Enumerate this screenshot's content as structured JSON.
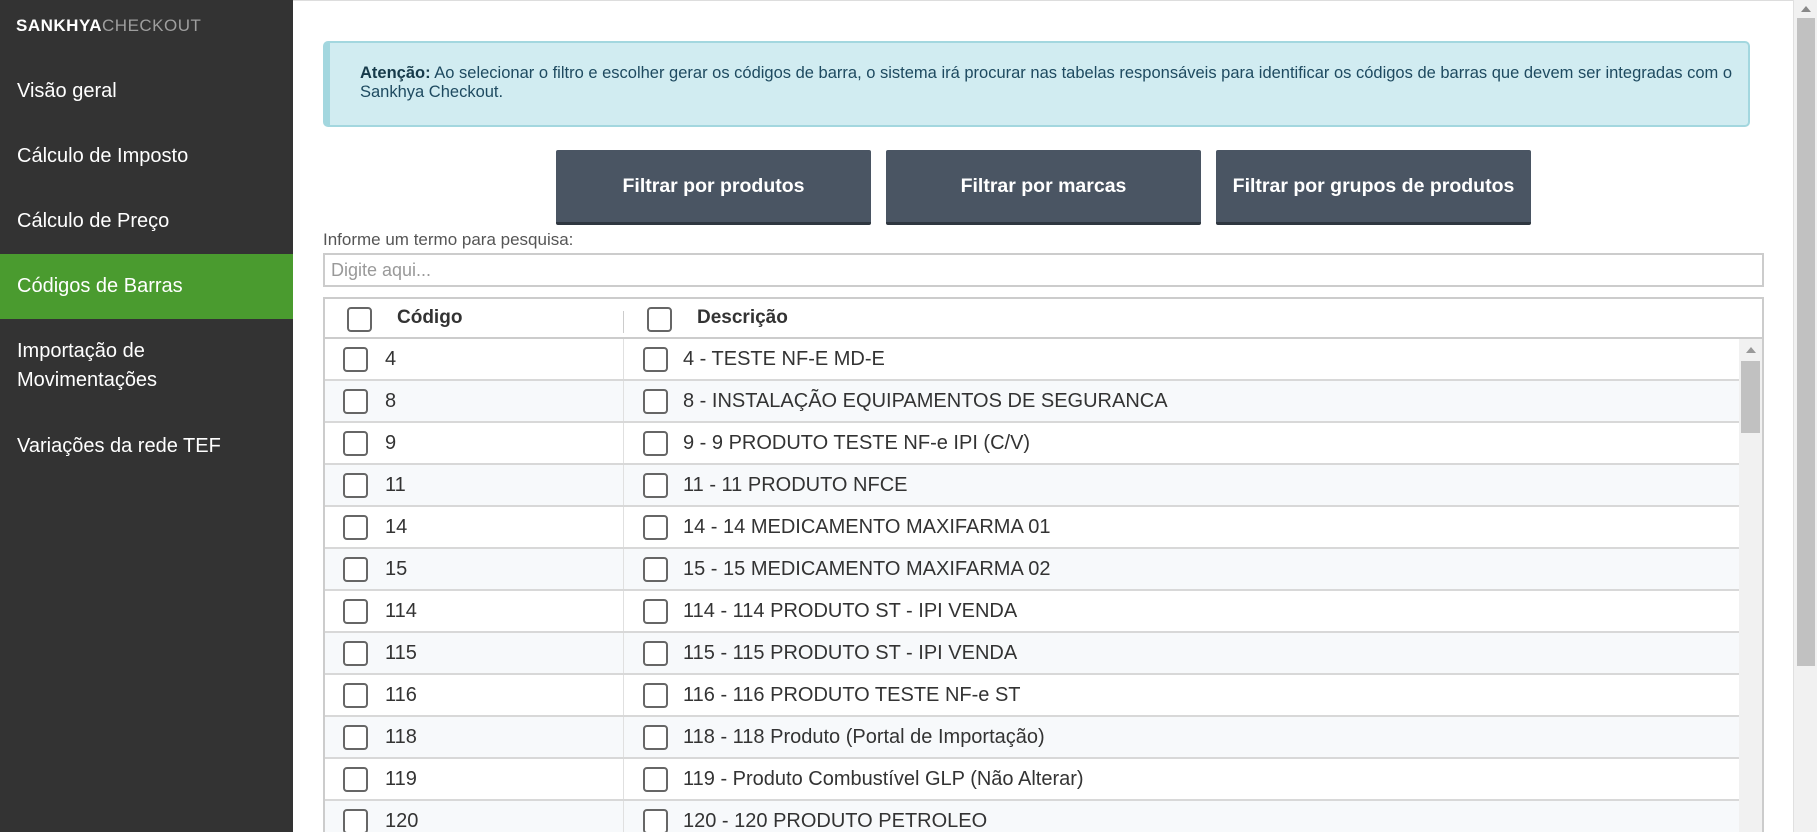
{
  "app": {
    "logo_brand": "SANKHYA",
    "logo_product": "CHECKOUT"
  },
  "sidebar": {
    "items": [
      {
        "label": "Visão geral",
        "active": false
      },
      {
        "label": "Cálculo de Imposto",
        "active": false
      },
      {
        "label": "Cálculo de Preço",
        "active": false
      },
      {
        "label": "Códigos de Barras",
        "active": true
      },
      {
        "label": "Importação de Movimentações",
        "active": false
      },
      {
        "label": "Variações da rede TEF",
        "active": false
      }
    ]
  },
  "alert": {
    "strong": "Atenção:",
    "text": " Ao selecionar o filtro e escolher gerar os códigos de barra, o sistema irá procurar nas tabelas responsáveis para identificar os códigos de barras que devem ser integradas com o Sankhya Checkout."
  },
  "filters": {
    "by_products": "Filtrar por produtos",
    "by_brands": "Filtrar por marcas",
    "by_product_groups": "Filtrar por grupos de produtos"
  },
  "search": {
    "label": "Informe um termo para pesquisa:",
    "placeholder": "Digite aqui...",
    "value": ""
  },
  "table": {
    "columns": [
      "Código",
      "Descrição"
    ],
    "rows": [
      {
        "code": "4",
        "description": "4 - TESTE NF-E MD-E"
      },
      {
        "code": "8",
        "description": "8 - INSTALAÇÃO EQUIPAMENTOS DE SEGURANCA"
      },
      {
        "code": "9",
        "description": "9 - 9 PRODUTO TESTE NF-e IPI (C/V)"
      },
      {
        "code": "11",
        "description": "11 - 11 PRODUTO NFCE"
      },
      {
        "code": "14",
        "description": "14 - 14 MEDICAMENTO MAXIFARMA 01"
      },
      {
        "code": "15",
        "description": "15 - 15 MEDICAMENTO MAXIFARMA 02"
      },
      {
        "code": "114",
        "description": "114 - 114 PRODUTO ST - IPI VENDA"
      },
      {
        "code": "115",
        "description": "115 - 115 PRODUTO ST - IPI VENDA"
      },
      {
        "code": "116",
        "description": "116 - 116 PRODUTO TESTE NF-e ST"
      },
      {
        "code": "118",
        "description": "118 - 118 Produto (Portal de Importação)"
      },
      {
        "code": "119",
        "description": "119 - Produto Combustível GLP (Não Alterar)"
      },
      {
        "code": "120",
        "description": "120 - 120 PRODUTO PETROLEO"
      }
    ]
  },
  "colors": {
    "sidebar_bg": "#333333",
    "active_item": "#4a9b2f",
    "alert_bg": "#d1ecf1",
    "button_bg": "#4a5563"
  }
}
